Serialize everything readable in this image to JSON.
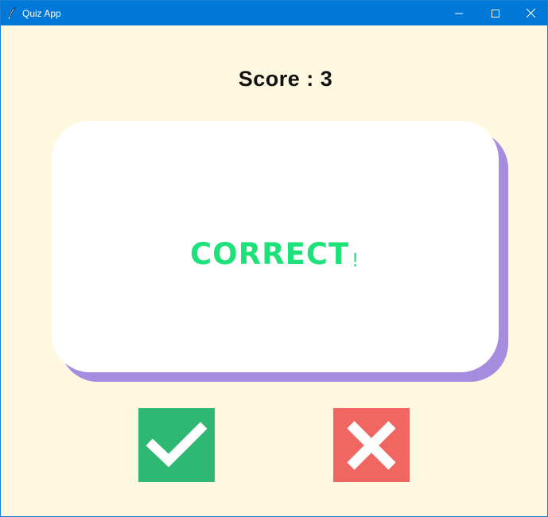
{
  "window": {
    "title": "Quiz App",
    "controls": [
      "minimize-icon",
      "maximize-icon",
      "close-icon"
    ],
    "titlebar_color": "#0078d7"
  },
  "quiz": {
    "score_text": "Score : 3",
    "feedback_text": "CORRECT",
    "feedback_mark": "!",
    "feedback_color": "#1de27a"
  },
  "buttons": {
    "true_icon": "checkmark-icon",
    "true_color": "#2fb874",
    "false_icon": "cross-icon",
    "false_color": "#ef6760"
  },
  "colors": {
    "background": "#fff8e1",
    "card": "#ffffff",
    "card_shadow": "#a58cde"
  }
}
